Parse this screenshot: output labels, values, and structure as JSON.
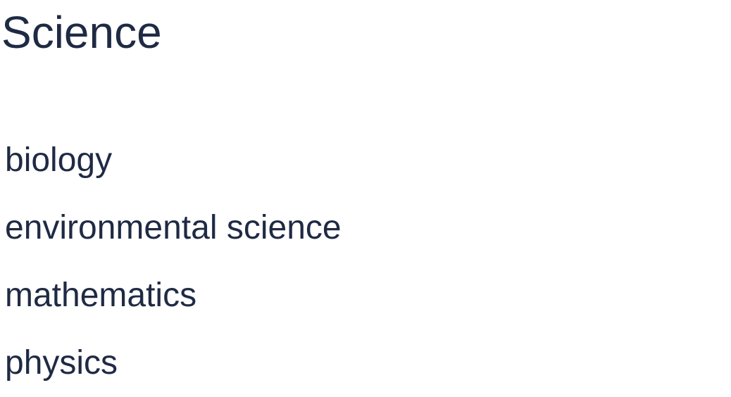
{
  "heading": {
    "title": "Science"
  },
  "subjects": [
    {
      "label": "biology"
    },
    {
      "label": "environmental science"
    },
    {
      "label": "mathematics"
    },
    {
      "label": "physics"
    }
  ],
  "colors": {
    "text": "#1f2a44",
    "background": "#ffffff"
  }
}
